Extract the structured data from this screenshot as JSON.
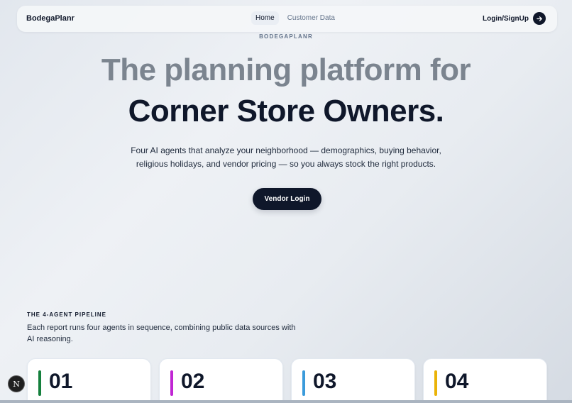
{
  "nav": {
    "brand": "BodegaPlanr",
    "links": [
      {
        "label": "Home",
        "active": true
      },
      {
        "label": "Customer Data",
        "active": false
      }
    ],
    "login_label": "Login/SignUp",
    "login_icon": "arrow-right-icon"
  },
  "hero": {
    "eyebrow": "BODEGAPLANR",
    "title_line1": "The planning platform for",
    "title_line2": "Corner Store Owners.",
    "subtitle": "Four AI agents that analyze your neighborhood — demographics, buying behavior, religious holidays, and vendor pricing — so you always stock the right products.",
    "cta_label": "Vendor Login"
  },
  "pipeline": {
    "label": "THE 4-AGENT PIPELINE",
    "description": "Each report runs four agents in sequence, combining public data sources with AI reasoning.",
    "cards": [
      {
        "number": "01",
        "color": "#15803d"
      },
      {
        "number": "02",
        "color": "#c026d3"
      },
      {
        "number": "03",
        "color": "#3b9bdb"
      },
      {
        "number": "04",
        "color": "#eab308"
      }
    ]
  },
  "badge": {
    "letter": "N"
  },
  "colors": {
    "primary": "#0f172a",
    "muted_heading": "#7b848f"
  }
}
